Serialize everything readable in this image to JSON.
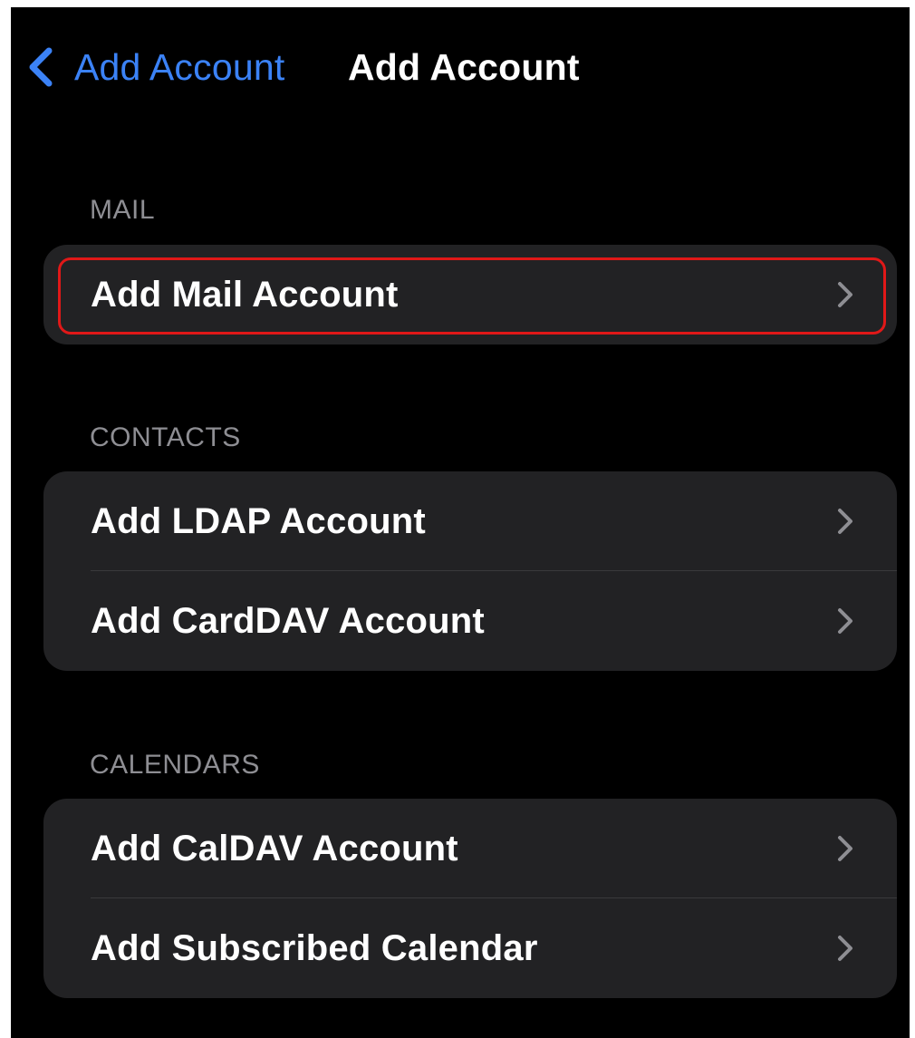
{
  "nav": {
    "back_label": "Add Account",
    "title": "Add Account"
  },
  "sections": [
    {
      "header": "MAIL",
      "rows": [
        {
          "label": "Add Mail Account"
        }
      ]
    },
    {
      "header": "CONTACTS",
      "rows": [
        {
          "label": "Add LDAP Account"
        },
        {
          "label": "Add CardDAV Account"
        }
      ]
    },
    {
      "header": "CALENDARS",
      "rows": [
        {
          "label": "Add CalDAV Account"
        },
        {
          "label": "Add Subscribed Calendar"
        }
      ]
    }
  ],
  "icons": {
    "back": "chevron-left-icon",
    "row": "chevron-right-icon"
  },
  "colors": {
    "background": "#000000",
    "group_background": "#222224",
    "accent": "#3b82f6",
    "section_header": "#8e8e93",
    "highlight": "#e01818"
  }
}
